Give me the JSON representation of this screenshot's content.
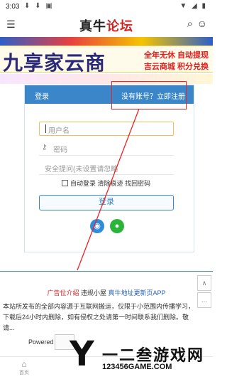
{
  "status_bar": {
    "time": "3:03",
    "left_icons": "⬇ ⬇ ▣",
    "right_icons": "▼ ◢ ▮"
  },
  "header": {
    "logo_part1": "真牛",
    "logo_part2": "论坛"
  },
  "banner": {
    "main_text": "九享家云商",
    "line1": "全年无休 自动提现",
    "line2": "吉云商城 积分兑换"
  },
  "login_panel": {
    "title": "登录",
    "register_prompt": "没有账号？立即注册",
    "username_placeholder": "用户名",
    "password_placeholder": "密码",
    "security_placeholder": "安全提问(未设置请忽略",
    "auto_login": "自动登录",
    "clear_traces": "清除痕迹",
    "recover_password": "找回密码",
    "login_button": "登录"
  },
  "footer": {
    "ad_link": "广告位介绍",
    "violation_link": "违规小屋",
    "update_link": "真牛地址更新页APP",
    "disclaimer": "本站所发布的全部内容源于互联网搬运，仅限于小范围内传播学习，下载后24小时内删除，如有侵权之处请第一时间联系我们删除。敬请...",
    "powered": "Powered"
  },
  "float_buttons": {
    "top": "∧",
    "chat": "…"
  },
  "bottom_nav": {
    "home_label": "首页"
  },
  "watermark": {
    "big": "Y",
    "text": "一二叁游戏网",
    "url": "123456GAME.COM"
  }
}
